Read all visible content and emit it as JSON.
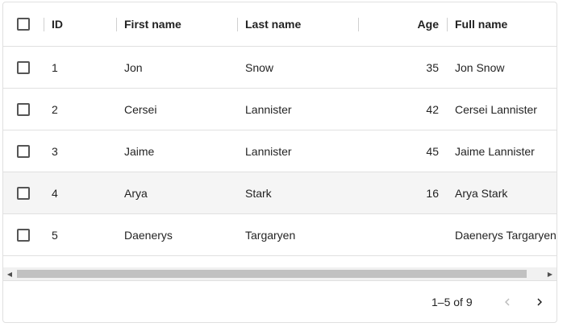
{
  "header": {
    "columns": {
      "id": "ID",
      "first": "First name",
      "last": "Last name",
      "age": "Age",
      "full": "Full name"
    }
  },
  "rows": [
    {
      "id": "1",
      "first": "Jon",
      "last": "Snow",
      "age": "35",
      "full": "Jon Snow"
    },
    {
      "id": "2",
      "first": "Cersei",
      "last": "Lannister",
      "age": "42",
      "full": "Cersei Lannister"
    },
    {
      "id": "3",
      "first": "Jaime",
      "last": "Lannister",
      "age": "45",
      "full": "Jaime Lannister"
    },
    {
      "id": "4",
      "first": "Arya",
      "last": "Stark",
      "age": "16",
      "full": "Arya Stark"
    },
    {
      "id": "5",
      "first": "Daenerys",
      "last": "Targaryen",
      "age": "",
      "full": "Daenerys Targaryen"
    }
  ],
  "footer": {
    "pagination_text": "1–5 of 9"
  },
  "icons": {
    "prev": "chevron-left-icon",
    "next": "chevron-right-icon"
  },
  "colors": {
    "border": "#e0e0e0",
    "hover_row": "#f5f5f5"
  }
}
